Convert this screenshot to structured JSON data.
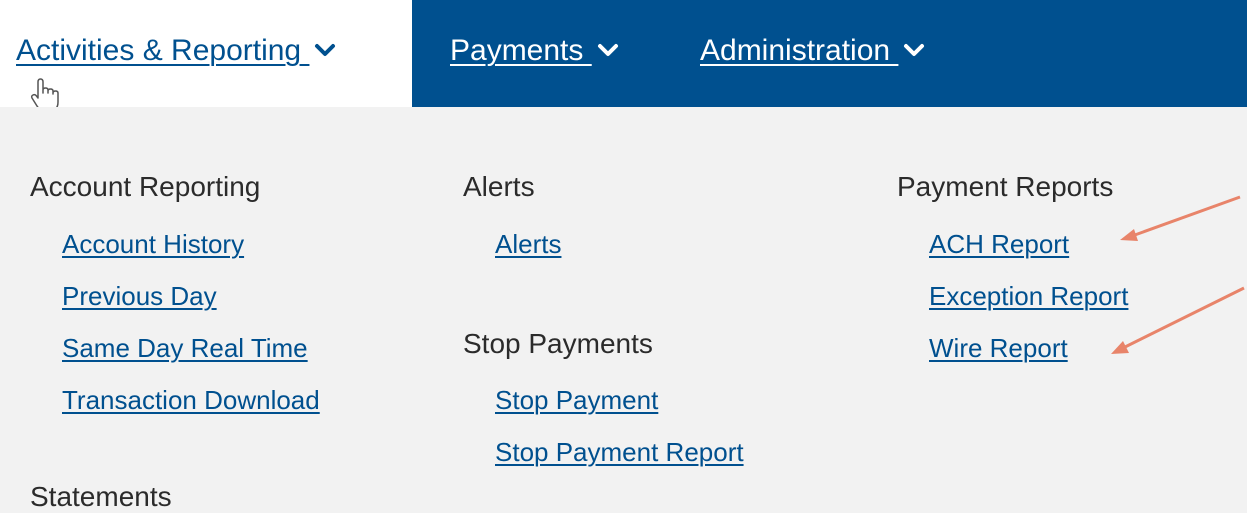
{
  "nav": {
    "items": [
      {
        "label": "Activities & Reporting "
      },
      {
        "label": "Payments "
      },
      {
        "label": "Administration "
      }
    ]
  },
  "menu": {
    "columns": [
      {
        "sections": [
          {
            "heading": "Account Reporting",
            "links": [
              "Account History",
              "Previous Day",
              "Same Day Real Time",
              "Transaction Download"
            ]
          },
          {
            "heading": "Statements",
            "links": []
          }
        ]
      },
      {
        "sections": [
          {
            "heading": "Alerts",
            "links": [
              "Alerts"
            ]
          },
          {
            "heading": "Stop Payments",
            "links": [
              "Stop Payment",
              "Stop Payment Report"
            ]
          }
        ]
      },
      {
        "sections": [
          {
            "heading": "Payment Reports",
            "links": [
              "ACH Report",
              "Exception Report",
              "Wire Report"
            ]
          }
        ]
      }
    ]
  },
  "colors": {
    "brand_blue": "#00508f",
    "annotation_arrow": "#e8846a"
  },
  "icons": [
    "chevron-down-icon",
    "hand-pointer-icon",
    "annotation-arrow-icon"
  ]
}
